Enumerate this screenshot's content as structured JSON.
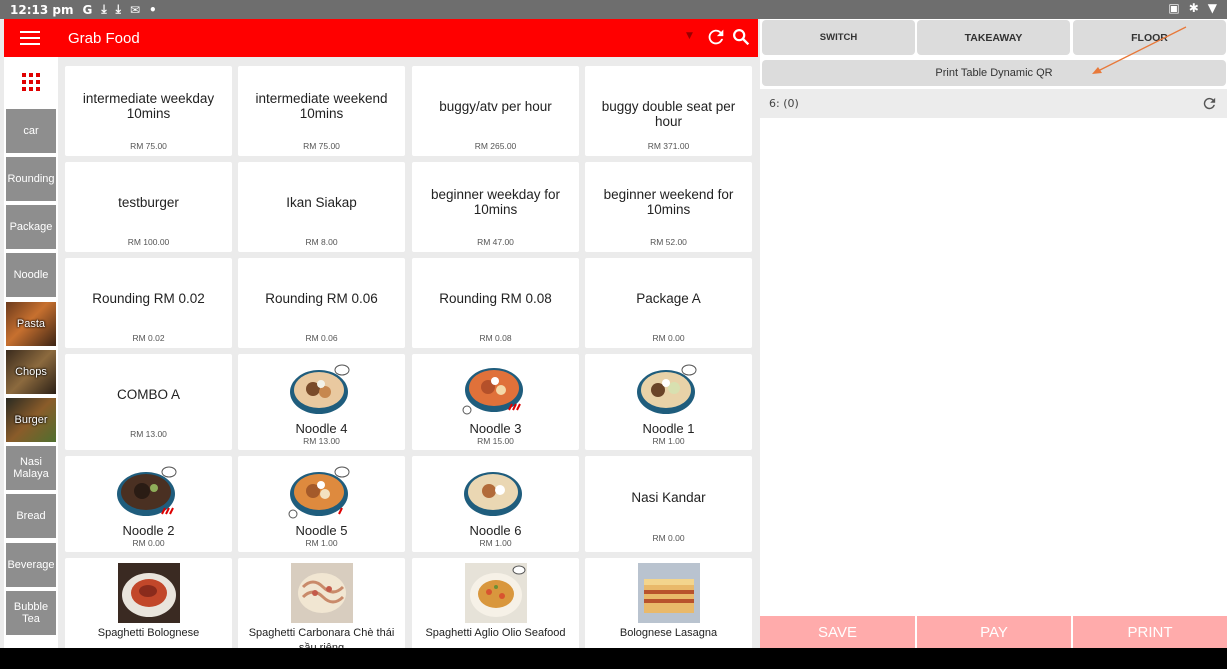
{
  "status_bar": {
    "time": "12:13 pm",
    "icons_left": [
      "G",
      "⤓",
      "⤓",
      "✉",
      "•"
    ]
  },
  "toolbar": {
    "title": "Grab Food"
  },
  "categories": [
    {
      "label": "",
      "icon": "grid-icon"
    },
    {
      "label": "car"
    },
    {
      "label": "Rounding"
    },
    {
      "label": "Package"
    },
    {
      "label": "Noodle"
    },
    {
      "label": "Pasta"
    },
    {
      "label": "Chops"
    },
    {
      "label": "Burger"
    },
    {
      "label": "Nasi Malaya"
    },
    {
      "label": "Bread"
    },
    {
      "label": "Beverage"
    },
    {
      "label": "Bubble Tea"
    }
  ],
  "products": [
    {
      "name": "intermediate weekday 10mins",
      "price": "RM 75.00"
    },
    {
      "name": "intermediate weekend 10mins",
      "price": "RM 75.00"
    },
    {
      "name": "buggy/atv per hour",
      "price": "RM 265.00"
    },
    {
      "name": "buggy double seat per hour",
      "price": "RM 371.00"
    },
    {
      "name": "testburger",
      "price": "RM 100.00"
    },
    {
      "name": "Ikan Siakap",
      "price": "RM 8.00"
    },
    {
      "name": "beginner weekday for 10mins",
      "price": "RM 47.00"
    },
    {
      "name": "beginner weekend for 10mins",
      "price": "RM 52.00"
    },
    {
      "name": "Rounding RM 0.02",
      "price": "RM 0.02"
    },
    {
      "name": "Rounding RM 0.06",
      "price": "RM 0.06"
    },
    {
      "name": "Rounding RM 0.08",
      "price": "RM 0.08"
    },
    {
      "name": "Package A",
      "price": "RM 0.00"
    },
    {
      "name": "COMBO A",
      "price": "RM 13.00"
    },
    {
      "name": "Noodle 4",
      "price": "RM 13.00"
    },
    {
      "name": "Noodle 3",
      "price": "RM 15.00"
    },
    {
      "name": "Noodle 1",
      "price": "RM 1.00"
    },
    {
      "name": "Noodle 2",
      "price": "RM 0.00"
    },
    {
      "name": "Noodle 5",
      "price": "RM 1.00"
    },
    {
      "name": "Noodle 6",
      "price": "RM 1.00"
    },
    {
      "name": "Nasi Kandar",
      "price": "RM 0.00"
    },
    {
      "name": "Spaghetti Bolognese",
      "price": ""
    },
    {
      "name": "Spaghetti Carbonara Chè thái sầu riêng",
      "price": ""
    },
    {
      "name": "Spaghetti Aglio Olio Seafood",
      "price": ""
    },
    {
      "name": "Bolognese Lasagna",
      "price": ""
    }
  ],
  "right_panel": {
    "tabs": [
      "SWITCH",
      "TAKEAWAY",
      "FLOOR"
    ],
    "qr_button": "Print Table Dynamic QR",
    "table_label": "6: (0)",
    "actions": [
      "SAVE",
      "PAY",
      "PRINT"
    ]
  },
  "colors": {
    "toolbar": "#ff0000",
    "action_buttons": "#ffabab",
    "annotation_arrow": "#e8793a"
  }
}
